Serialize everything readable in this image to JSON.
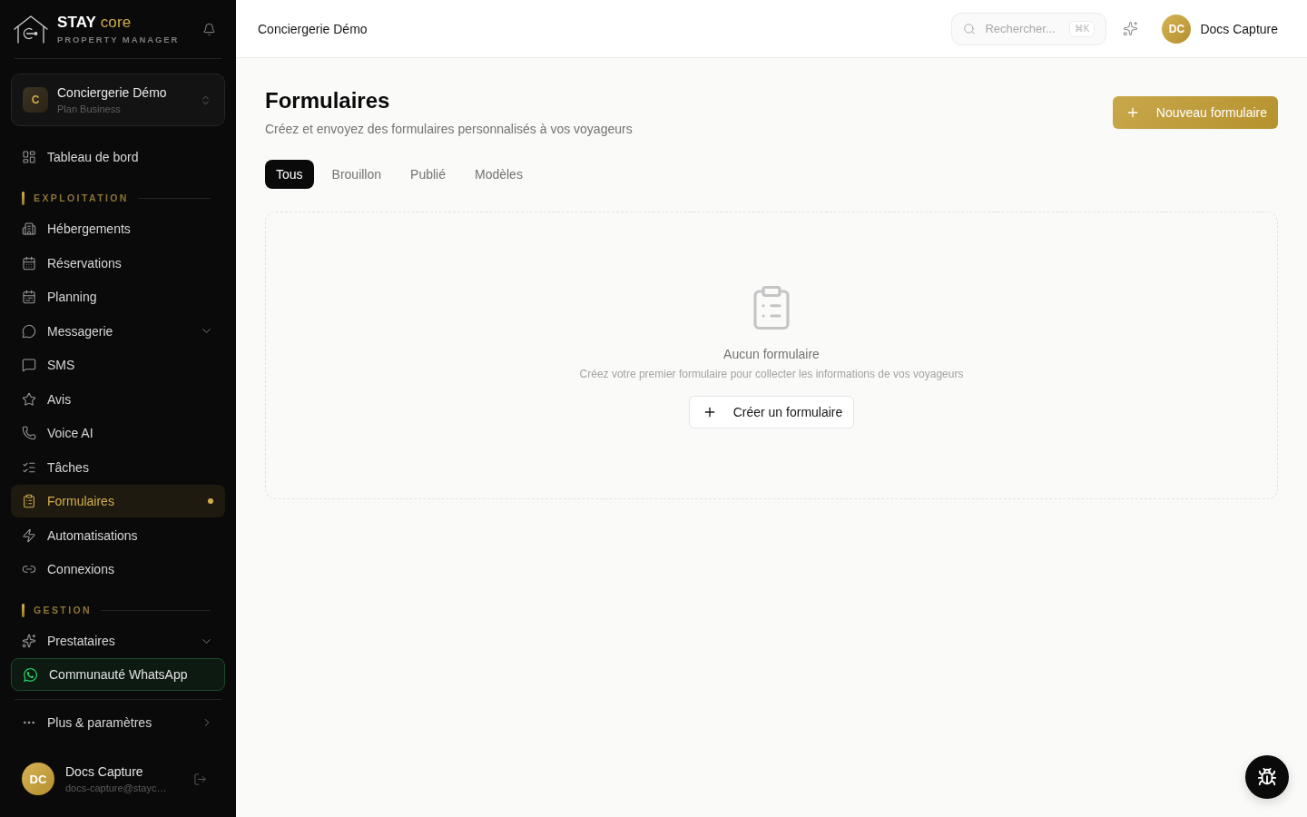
{
  "sidebar": {
    "brand": {
      "wordmark": "**STAY** core",
      "tagline": "PROPERTY MANAGER"
    },
    "workspace": {
      "initial": "C",
      "name": "Conciergerie Démo",
      "plan": "Plan Business"
    },
    "home": {
      "label": "Tableau de bord",
      "selected": false
    },
    "sections": [
      {
        "title": "EXPLOITATION",
        "items": [
          {
            "label": "Hébergements",
            "kind": "link",
            "selected": false
          },
          {
            "label": "Réservations",
            "kind": "link",
            "selected": false
          },
          {
            "label": "Planning",
            "kind": "link",
            "selected": false
          },
          {
            "label": "Messagerie",
            "kind": "group",
            "selected": false
          },
          {
            "label": "SMS",
            "kind": "link",
            "selected": false
          },
          {
            "label": "Avis",
            "kind": "link",
            "selected": false
          },
          {
            "label": "Voice AI",
            "kind": "link",
            "selected": false
          },
          {
            "label": "Tâches",
            "kind": "link",
            "selected": false
          },
          {
            "label": "Formulaires",
            "kind": "link",
            "selected": true
          },
          {
            "label": "Automatisations",
            "kind": "link",
            "selected": false
          },
          {
            "label": "Connexions",
            "kind": "link",
            "selected": false
          }
        ]
      },
      {
        "title": "GESTION",
        "items": [
          {
            "label": "Prestataires",
            "kind": "group",
            "selected": false
          }
        ]
      }
    ],
    "community": {
      "label": "Communauté WhatsApp",
      "selected": false
    },
    "more": {
      "label": "Plus & paramètres",
      "selected": false
    },
    "user": {
      "initials": "DC",
      "name": "Docs Capture",
      "email": "docs-capture@stayc…"
    }
  },
  "header": {
    "title": "Conciergerie Démo",
    "search": {
      "placeholder": "Rechercher...",
      "shortcut": "⌘K"
    },
    "user": {
      "initials": "DC",
      "name": "Docs Capture"
    }
  },
  "page": {
    "title": "Formulaires",
    "subtitle": "Créez et envoyez des formulaires personnalisés à vos voyageurs",
    "primary_action": "Nouveau formulaire",
    "tabs": [
      {
        "label": "Tous",
        "selected": true
      },
      {
        "label": "Brouillon",
        "selected": false
      },
      {
        "label": "Publié",
        "selected": false
      },
      {
        "label": "Modèles",
        "selected": false
      }
    ],
    "empty_state": {
      "title": "Aucun formulaire",
      "text": "Créez votre premier formulaire pour collecter les informations de vos voyageurs",
      "action": "Créer un formulaire"
    }
  }
}
